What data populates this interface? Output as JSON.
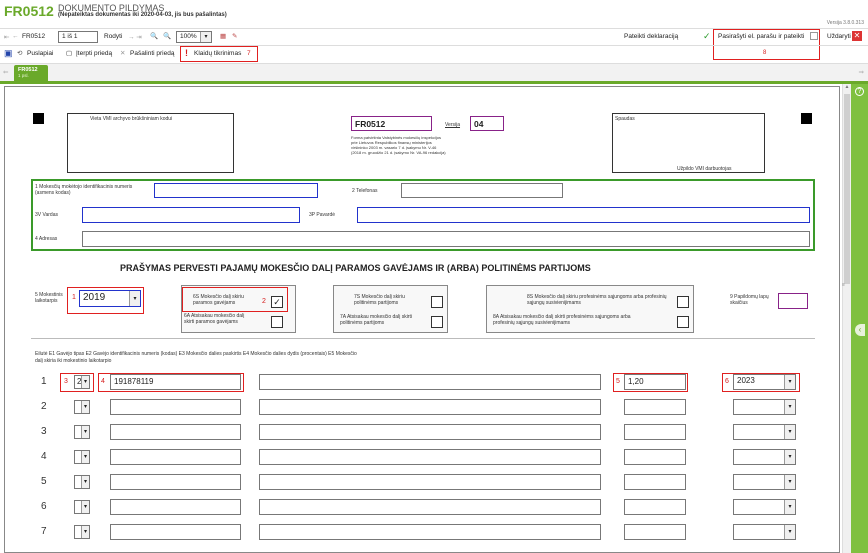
{
  "header": {
    "code": "FR0512",
    "title": "DOKUMENTO PILDYMAS",
    "subtitle": "(Nepateiktas dokumentas iki 2020-04-03, jis bus pašalintas)",
    "version": "Versija 3.8.0.313"
  },
  "nav": {
    "form_code": "FR0512",
    "page_field": "1 iš 1",
    "show_label": "Rodyti",
    "zoom": "100%",
    "submitted_label": "Pateikti deklaraciją",
    "sign_label": "Pasirašyti el. parašu ir pateikti",
    "close_label": "Uždaryti"
  },
  "toolbar": {
    "paste_label": "Puslapiai",
    "attach_label": "Įterpti priedą",
    "remove_label": "Pašalinti priedą",
    "errors_label": "Klaidų tikrinimas",
    "errors_marker": "7",
    "sign_marker": "8"
  },
  "tab": {
    "label": "FR0512",
    "sub": "1 psl."
  },
  "form": {
    "archive_box_label": "Vieta VMI archyvo brūkšniniam kodui",
    "form_code_value": "FR0512",
    "version_label": "Versija",
    "version_value": "04",
    "approval_text_1": "Forma patvirtinta Valstybinės mokesčių inspekcijos",
    "approval_text_2": "prie Lietuvos Respublikos finansų ministerijos",
    "approval_text_3": "viršininko 2003 m. vasario 7 d. įsakymu Nr. V-46",
    "approval_text_4": "(2018 m. gruodžio 21 d. įsakymo Nr. VA-96 redakcija)",
    "stamp_label": "Spaudas",
    "officer_label": "Užpildo VMI darbuotojas",
    "taxpayer_id_label": "1 Mokesčių mokėtojo identifikacinis numeris (asmens kodas)",
    "phone_label": "2 Telefonas",
    "name_label": "3V Vardas",
    "surname_label": "3P Pavardė",
    "address_label": "4 Adresas",
    "main_title": "PRAŠYMAS PERVESTI PAJAMŲ MOKESČIO DALĮ PARAMOS GAVĖJAMS IR (ARBA) POLITINĖMS PARTIJOMS",
    "tax_period_label": "5 Mokestinis laikotarpis",
    "tax_period_marker": "1",
    "tax_period_value": "2019",
    "support_label": "6S Mokesčio dalį skiriu paramos gavėjams",
    "support_marker": "2",
    "support_checked": "✓",
    "support_cancel_label": "6A Atsisakau mokesčio dalį skirti paramos gavėjams",
    "party_label": "7S Mokesčio dalį skiriu politinėms partijoms",
    "party_cancel_label": "7A Atsisakau mokesčio dalį skirti politinėms partijoms",
    "union_label": "8S Mokesčio dalį skiriu profesinėms sąjungoms arba profesinių sąjungų susivienijimams",
    "union_cancel_label": "8A Atsisakau mokesčio dalį skirti profesinėms sąjungoms arba profesinių sąjungų susivienijimams",
    "extra_pages_label": "9 Papildomų lapų skaičius",
    "columns_text": "Eilutė E1 Gavėjo tipas E2 Gavėjo identifikacinis numeris (kodas) E3 Mokesčio dalies paskirtis E4 Mokesčio dalies dydis (procentais) E5 Mokesčio dalį skiria iki mokestinio laikotarpio"
  },
  "rows": [
    {
      "num": "1",
      "type": "2",
      "id": "191878119",
      "purpose": "",
      "percent": "1,20",
      "year": "2023"
    },
    {
      "num": "2",
      "type": "",
      "id": "",
      "purpose": "",
      "percent": "",
      "year": ""
    },
    {
      "num": "3",
      "type": "",
      "id": "",
      "purpose": "",
      "percent": "",
      "year": ""
    },
    {
      "num": "4",
      "type": "",
      "id": "",
      "purpose": "",
      "percent": "",
      "year": ""
    },
    {
      "num": "5",
      "type": "",
      "id": "",
      "purpose": "",
      "percent": "",
      "year": ""
    },
    {
      "num": "6",
      "type": "",
      "id": "",
      "purpose": "",
      "percent": "",
      "year": ""
    },
    {
      "num": "7",
      "type": "",
      "id": "",
      "purpose": "",
      "percent": "",
      "year": ""
    }
  ],
  "row1_markers": {
    "type": "3",
    "id": "4",
    "percent": "5",
    "year": "6"
  },
  "colors": {
    "brand_green": "#6aa92a",
    "accent_red": "#e02020",
    "form_green": "#3a9a2a",
    "form_blue": "#2233cc"
  }
}
